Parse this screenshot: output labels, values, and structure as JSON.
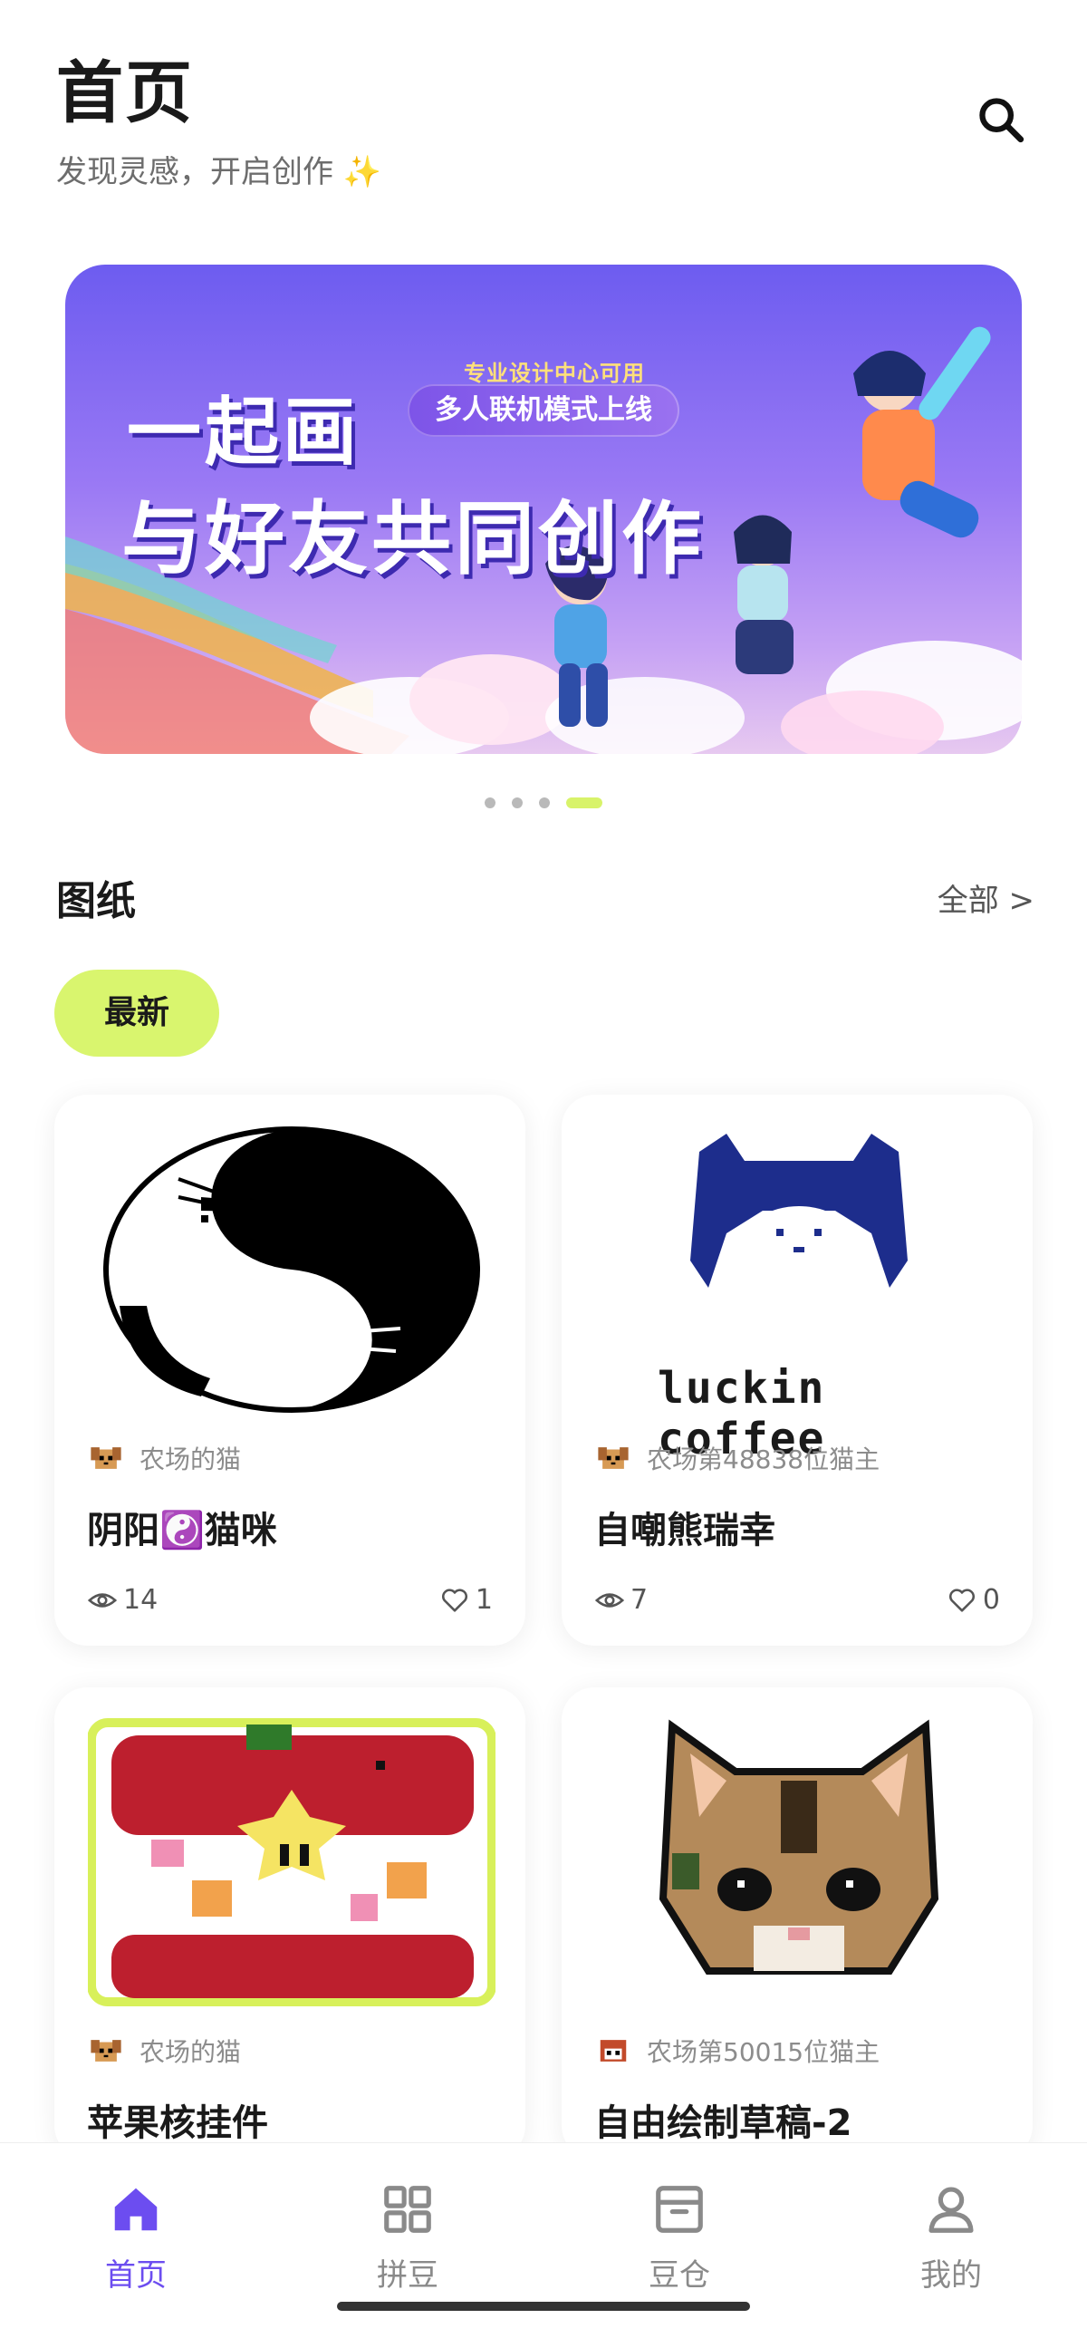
{
  "header": {
    "title": "首页",
    "subtitle": "发现灵感，开启创作 ✨",
    "search_icon": "search-icon"
  },
  "banner": {
    "tag": "专业设计中心可用",
    "pill": "多人联机模式上线",
    "headline_1": "一起画",
    "headline_2": "与好友共同创作",
    "page_count": 4,
    "active_page": 4
  },
  "section": {
    "title": "图纸",
    "see_all": "全部 >"
  },
  "filter": {
    "active_chip": "最新"
  },
  "cards": [
    {
      "author": "农场的猫",
      "name": "阴阳☯️猫咪",
      "views": "14",
      "likes": "1",
      "image_icon": "yin-yang-cat-pixel"
    },
    {
      "author": "农场第48838位猫主",
      "name": "自嘲熊瑞幸",
      "views": "7",
      "likes": "0",
      "image_icon": "luckin-coffee-pixel",
      "image_text": "luckin coffee"
    },
    {
      "author": "农场的猫",
      "name": "苹果核挂件",
      "image_icon": "apple-core-pixel"
    },
    {
      "author": "农场第50015位猫主",
      "name": "自由绘制草稿-2",
      "image_icon": "tabby-cat-pixel"
    }
  ],
  "nav": {
    "items": [
      {
        "label": "首页",
        "icon": "home-icon",
        "active": true
      },
      {
        "label": "拼豆",
        "icon": "grid-icon",
        "active": false
      },
      {
        "label": "豆仓",
        "icon": "archive-icon",
        "active": false
      },
      {
        "label": "我的",
        "icon": "profile-icon",
        "active": false
      }
    ]
  },
  "colors": {
    "accent_purple": "#6c4df0",
    "accent_lime": "#d9f56e"
  }
}
